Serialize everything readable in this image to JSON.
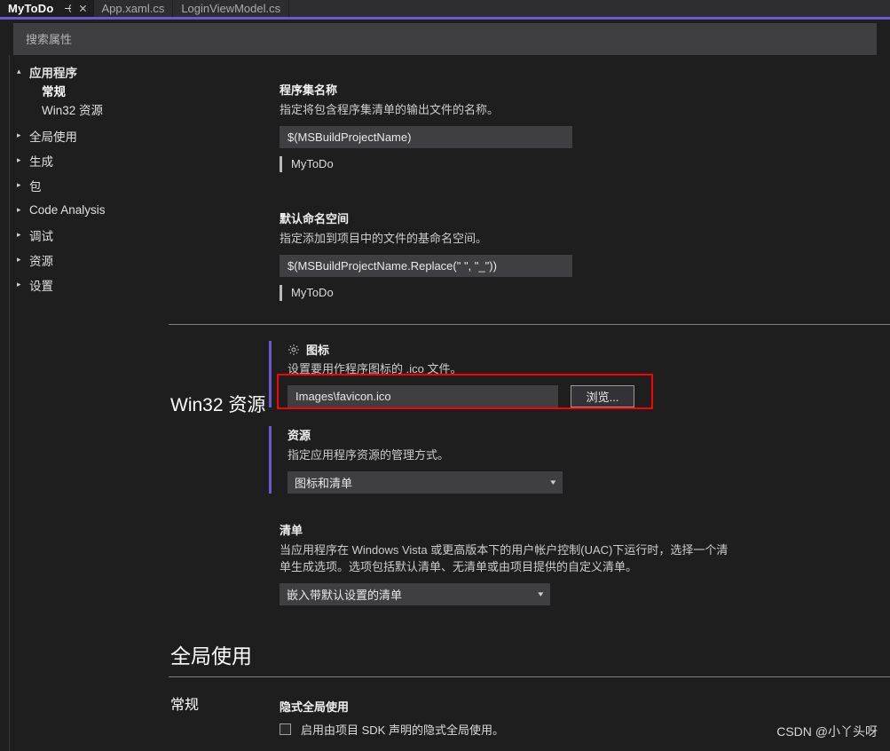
{
  "tabs": [
    {
      "label": "MyToDo",
      "active": true,
      "icons": [
        "pin-icon",
        "close-icon"
      ]
    },
    {
      "label": "App.xaml.cs",
      "active": false
    },
    {
      "label": "LoginViewModel.cs",
      "active": false
    }
  ],
  "search": {
    "placeholder": "搜索属性",
    "value": ""
  },
  "sidebar": {
    "groups": [
      {
        "label": "应用程序",
        "arrow": "▴",
        "expanded": true,
        "children": [
          {
            "label": "常规",
            "selected": true
          },
          {
            "label": "Win32 资源",
            "selected": false
          }
        ]
      },
      {
        "label": "全局使用",
        "arrow": "▸",
        "expanded": false,
        "children": []
      },
      {
        "label": "生成",
        "arrow": "▸",
        "expanded": false,
        "children": []
      },
      {
        "label": "包",
        "arrow": "▸",
        "expanded": false,
        "children": []
      },
      {
        "label": "Code Analysis",
        "arrow": "▸",
        "expanded": false,
        "children": []
      },
      {
        "label": "调试",
        "arrow": "▸",
        "expanded": false,
        "children": []
      },
      {
        "label": "资源",
        "arrow": "▸",
        "expanded": false,
        "children": []
      },
      {
        "label": "设置",
        "arrow": "▸",
        "expanded": false,
        "children": []
      }
    ]
  },
  "application": {
    "assembly_name": {
      "label": "程序集名称",
      "description": "指定将包含程序集清单的输出文件的名称。",
      "value": "$(MSBuildProjectName)",
      "preview": "MyToDo"
    },
    "default_namespace": {
      "label": "默认命名空间",
      "description": "指定添加到项目中的文件的基命名空间。",
      "value": "$(MSBuildProjectName.Replace(\" \", \"_\"))",
      "preview": "MyToDo"
    }
  },
  "win32": {
    "section_label": "Win32 资源",
    "icon": {
      "icon_name": "gear-icon",
      "label": "图标",
      "description": "设置要用作程序图标的 .ico 文件。",
      "value": "Images\\favicon.ico",
      "browse_label": "浏览...",
      "highlight_color": "#ff0000"
    },
    "resources": {
      "label": "资源",
      "description": "指定应用程序资源的管理方式。",
      "value": "图标和清单"
    },
    "manifest": {
      "label": "清单",
      "description": "当应用程序在 Windows Vista 或更高版本下的用户帐户控制(UAC)下运行时，选择一个清单生成选项。选项包括默认清单、无清单或由项目提供的自定义清单。",
      "value": "嵌入带默认设置的清单"
    }
  },
  "global_usings": {
    "title": "全局使用",
    "section_label": "常规",
    "implicit": {
      "label": "隐式全局使用",
      "checkbox_label": "启用由项目 SDK 声明的隐式全局使用。",
      "checked": false
    }
  },
  "watermark": "CSDN @小丫头呀",
  "colors": {
    "accent_purple": "#6a5acd",
    "highlight_red": "#ff0000",
    "background": "#1e1e1e",
    "input_background": "#3f3f41"
  }
}
